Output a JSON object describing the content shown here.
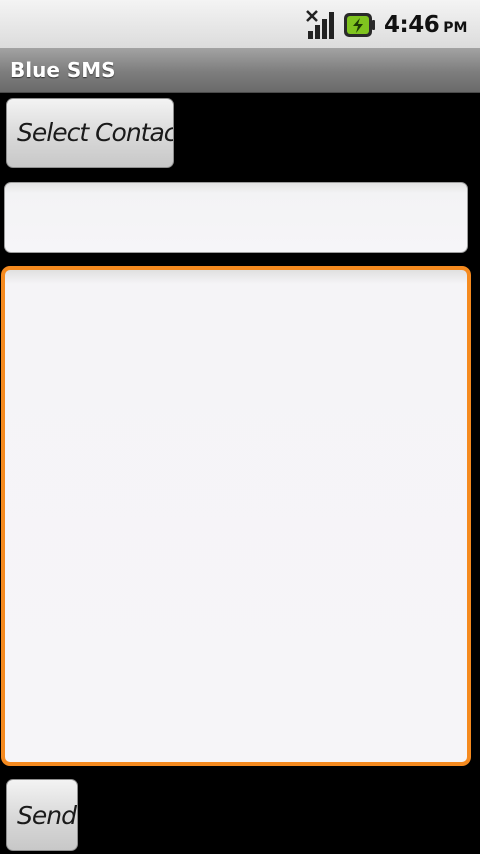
{
  "status_bar": {
    "time": "4:46",
    "ampm": "PM",
    "signal_icon": "no-signal-icon",
    "battery_icon": "battery-charging-icon"
  },
  "app": {
    "title": "Blue SMS"
  },
  "form": {
    "select_contact_label": "Select Contact",
    "number_value": "",
    "message_value": "",
    "send_label": "Send"
  },
  "colors": {
    "focus_accent": "#f58a1f",
    "battery_green": "#7fc41f"
  }
}
